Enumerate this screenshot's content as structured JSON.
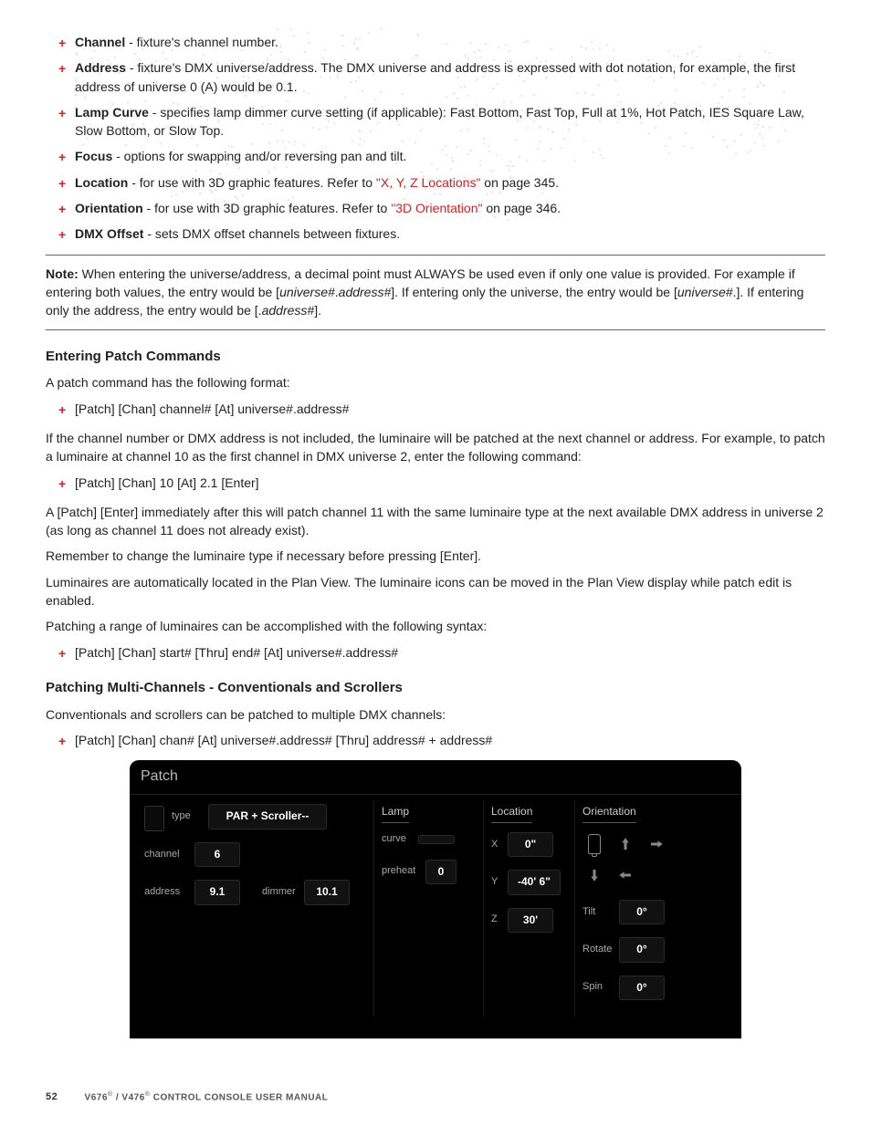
{
  "bullets1": {
    "channel_term": "Channel",
    "channel_text": " - fixture's channel number.",
    "address_term": "Address",
    "address_text": " - fixture's DMX universe/address. The DMX universe and address is expressed with dot notation, for example, the first address of universe 0 (A) would be 0.1.",
    "lampcurve_term": "Lamp Curve",
    "lampcurve_text": " - specifies lamp dimmer curve setting (if applicable): Fast Bottom, Fast Top, Full at 1%, Hot Patch, IES Square Law, Slow Bottom, or Slow Top.",
    "focus_term": "Focus",
    "focus_text": " - options for swapping and/or reversing pan and tilt.",
    "location_term": "Location",
    "location_text_before": " - for use with 3D graphic features. Refer to ",
    "location_link": "\"X, Y, Z Locations\"",
    "location_text_after": " on page 345.",
    "orientation_term": "Orientation",
    "orientation_text_before": " - for use with 3D graphic features. Refer to ",
    "orientation_link": "\"3D Orientation\"",
    "orientation_text_after": " on page 346.",
    "dmxoffset_term": "DMX Offset",
    "dmxoffset_text": " - sets DMX offset channels between fixtures."
  },
  "note": {
    "label": "Note:",
    "t1": "  When entering the universe/address, a decimal point must ALWAYS be used even if only one value is provided. For example if entering both values, the entry would be [",
    "i1": "universe#",
    "t2": ".",
    "i2": "address#",
    "t3": "]. If entering only the universe, the entry would be [",
    "i3": "universe#",
    "t4": ".]. If entering only the address, the entry would be [.",
    "i4": "address#",
    "t5": "]."
  },
  "h_entering": "Entering Patch Commands",
  "p_entering_intro": "A patch command has the following format:",
  "b_entering_fmt": "[Patch] [Chan] channel# [At] universe#.address#",
  "p_entering_2": "If the channel number or DMX address is not included, the luminaire will be patched at the next channel or address. For example, to patch a luminaire at channel 10 as the first channel in DMX universe 2, enter the following command:",
  "b_entering_ex": "[Patch] [Chan] 10 [At] 2.1 [Enter]",
  "p_entering_3": "A [Patch] [Enter] immediately after this will patch channel 11 with the same luminaire type at the next available DMX address in universe 2 (as long as channel 11 does not already exist).",
  "p_entering_4": "Remember to change the luminaire type if necessary before pressing [Enter].",
  "p_entering_5": "Luminaires are automatically located in the Plan View. The luminaire icons can be moved in the Plan View display while patch edit is enabled.",
  "p_entering_6": "Patching a range of luminaires can be accomplished with the following syntax:",
  "b_entering_range": "[Patch] [Chan] start# [Thru] end# [At] universe#.address#",
  "h_multi": "Patching Multi-Channels - Conventionals and Scrollers",
  "p_multi_intro": "Conventionals and scrollers can be patched to multiple DMX channels:",
  "b_multi_fmt": "[Patch] [Chan] chan# [At] universe#.address# [Thru] address# + address#",
  "patch": {
    "title": "Patch",
    "type_label": "type",
    "type_value": "PAR + Scroller--",
    "channel_label": "channel",
    "channel_value": "6",
    "address_label": "address",
    "address_value": "9.1",
    "dimmer_label": "dimmer",
    "dimmer_value": "10.1",
    "lamp_label": "Lamp",
    "curve_label": "curve",
    "preheat_label": "preheat",
    "preheat_value": "0",
    "location_label": "Location",
    "x_label": "X",
    "x_value": "0\"",
    "y_label": "Y",
    "y_value": "-40' 6\"",
    "z_label": "Z",
    "z_value": "30'",
    "orientation_label": "Orientation",
    "tilt_label": "Tilt",
    "tilt_value": "0°",
    "rotate_label": "Rotate",
    "rotate_value": "0°",
    "spin_label": "Spin",
    "spin_value": "0°"
  },
  "footer": {
    "page": "52",
    "doc_a": "V676",
    "doc_b": " / V476",
    "doc_c": " CONTROL CONSOLE USER MANUAL"
  }
}
